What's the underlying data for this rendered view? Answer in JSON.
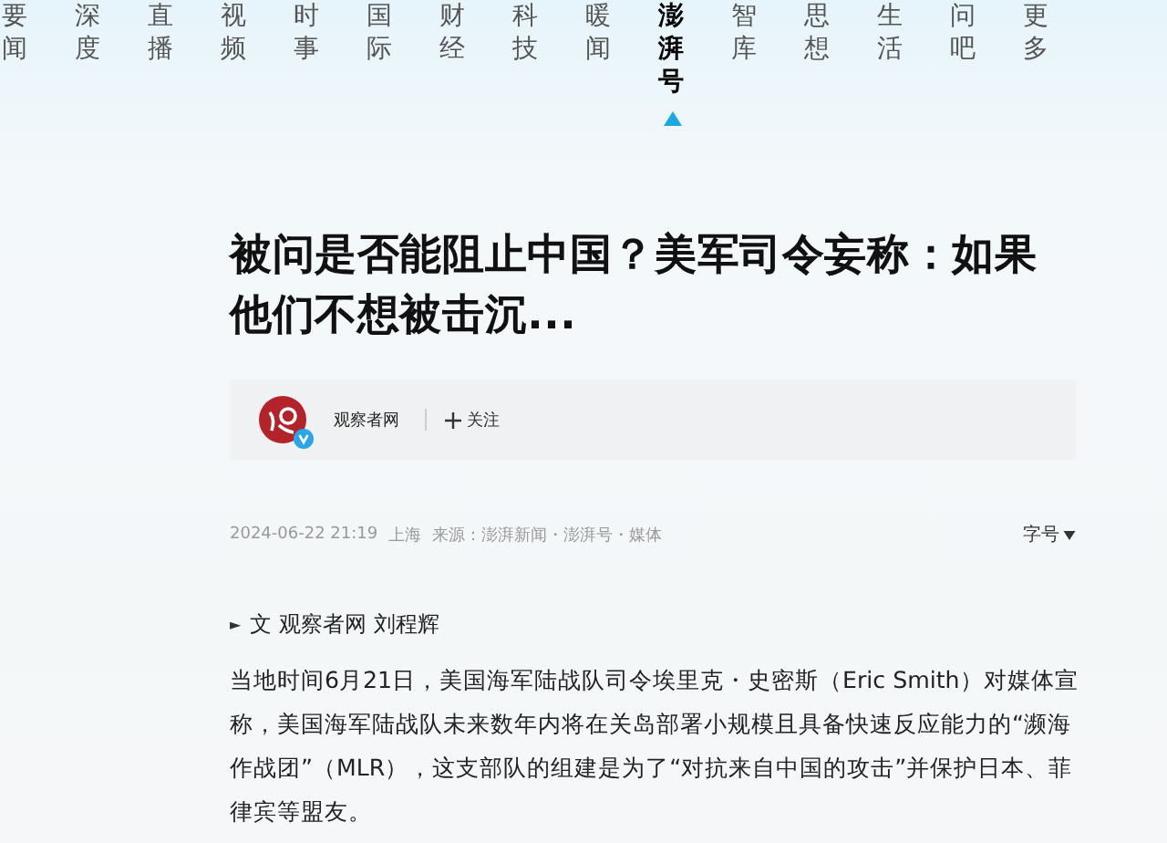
{
  "nav": [
    {
      "label": "要闻",
      "selected": false
    },
    {
      "label": "深度",
      "selected": false
    },
    {
      "label": "直播",
      "selected": false
    },
    {
      "label": "视频",
      "selected": false
    },
    {
      "label": "时事",
      "selected": false
    },
    {
      "label": "国际",
      "selected": false
    },
    {
      "label": "财经",
      "selected": false
    },
    {
      "label": "科技",
      "selected": false
    },
    {
      "label": "暖闻",
      "selected": false
    },
    {
      "label": "澎湃号",
      "selected": true
    },
    {
      "label": "智库",
      "selected": false
    },
    {
      "label": "思想",
      "selected": false
    },
    {
      "label": "生活",
      "selected": false
    },
    {
      "label": "问吧",
      "selected": false
    },
    {
      "label": "更多",
      "selected": false
    }
  ],
  "article": {
    "title": "被问是否能阻止中国？美军司令妄称：如果他们不想被击沉...",
    "author": {
      "name": "观察者网",
      "verified": true,
      "follow": "关注"
    },
    "meta": {
      "time": "2024-06-22 21:19",
      "location": "上海",
      "source": "来源：澎湃新闻・澎湃号・媒体",
      "font_size": "字号"
    },
    "byline_marker": "►",
    "byline": "文 观察者网 刘程辉",
    "paragraphs": [
      "当地时间6月21日，美国海军陆战队司令埃里克・史密斯（Eric Smith）对媒体宣称，美国海军陆战队未来数年内将在关岛部署小规模且具备快速反应能力的“濒海作战团”（MLR），这支部队的组建是为了“对抗来自中国的攻击”并保护日本、菲律宾等盟友。"
    ]
  }
}
